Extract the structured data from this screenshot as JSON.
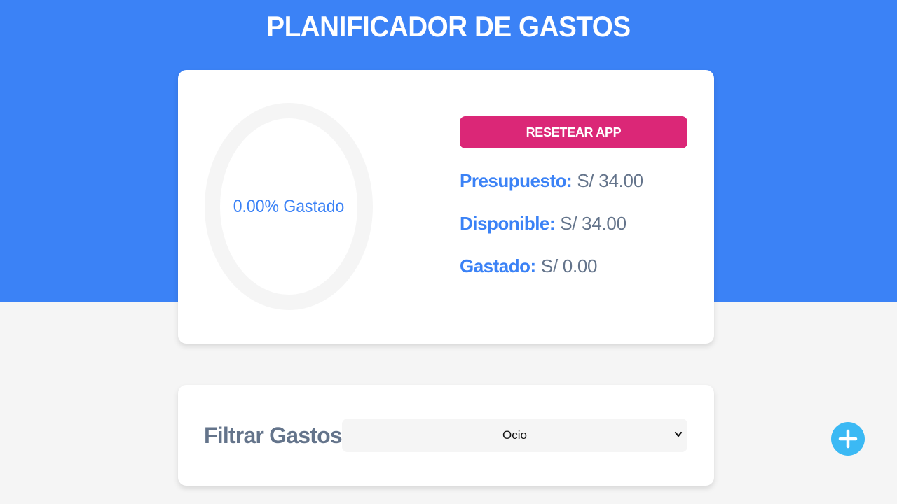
{
  "header": {
    "title": "PLANIFICADOR DE GASTOS"
  },
  "budget": {
    "percent_spent": 0,
    "ring_label": "0.00% Gastado",
    "reset_label": "RESETEAR APP",
    "presupuesto_label": "Presupuesto:",
    "presupuesto_value": "S/ 34.00",
    "disponible_label": "Disponible:",
    "disponible_value": "S/ 34.00",
    "gastado_label": "Gastado:",
    "gastado_value": "S/ 0.00"
  },
  "filter": {
    "label": "Filtrar Gastos",
    "selected": "Ocio"
  },
  "icons": {
    "add": "plus-icon",
    "select": "chevron-down-icon"
  },
  "colors": {
    "primary": "#3b82f6",
    "reset": "#db2777",
    "add_button": "#3bb9f4",
    "ring_track": "#f5f5f5"
  }
}
